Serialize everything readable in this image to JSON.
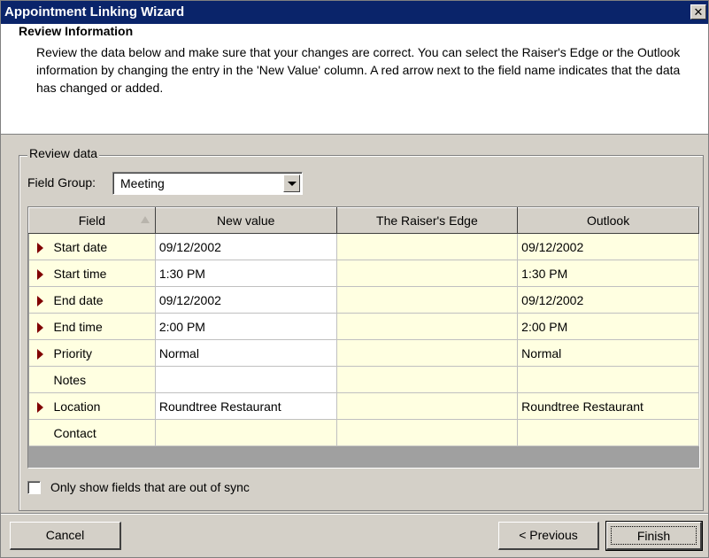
{
  "window": {
    "title": "Appointment Linking Wizard",
    "close_label": "✕"
  },
  "header": {
    "title": "Review  Information",
    "description": "Review the data below and make sure that your changes are correct.  You can select the Raiser's Edge or the Outlook information by changing the entry in the 'New Value' column.  A red arrow next to the field name indicates that the data has changed or added."
  },
  "review": {
    "group_label": "Review data",
    "field_group_label": "Field Group:",
    "field_group_value": "Meeting",
    "columns": [
      "Field",
      "New value",
      "The Raiser's Edge",
      "Outlook"
    ],
    "rows": [
      {
        "field": "Start date",
        "new_value": "09/12/2002",
        "raisers_edge": "",
        "outlook": "09/12/2002",
        "changed": true
      },
      {
        "field": "Start time",
        "new_value": "1:30 PM",
        "raisers_edge": "",
        "outlook": "1:30 PM",
        "changed": true
      },
      {
        "field": "End date",
        "new_value": "09/12/2002",
        "raisers_edge": "",
        "outlook": "09/12/2002",
        "changed": true
      },
      {
        "field": "End time",
        "new_value": "2:00 PM",
        "raisers_edge": "",
        "outlook": "2:00 PM",
        "changed": true
      },
      {
        "field": "Priority",
        "new_value": "Normal",
        "raisers_edge": "",
        "outlook": "Normal",
        "changed": true
      },
      {
        "field": "Notes",
        "new_value": "",
        "raisers_edge": "",
        "outlook": "",
        "changed": false
      },
      {
        "field": "Location",
        "new_value": "Roundtree Restaurant",
        "raisers_edge": "",
        "outlook": "Roundtree Restaurant",
        "changed": true
      },
      {
        "field": "Contact",
        "new_value": "",
        "raisers_edge": "",
        "outlook": "",
        "changed": false
      }
    ],
    "out_of_sync_label": "Only show fields that are out of sync",
    "out_of_sync_checked": false
  },
  "buttons": {
    "cancel": "Cancel",
    "previous": "< Previous",
    "finish": "Finish"
  },
  "colors": {
    "title_bar": "#0a246a",
    "changed_arrow": "#800000",
    "row_highlight": "#ffffe1"
  }
}
